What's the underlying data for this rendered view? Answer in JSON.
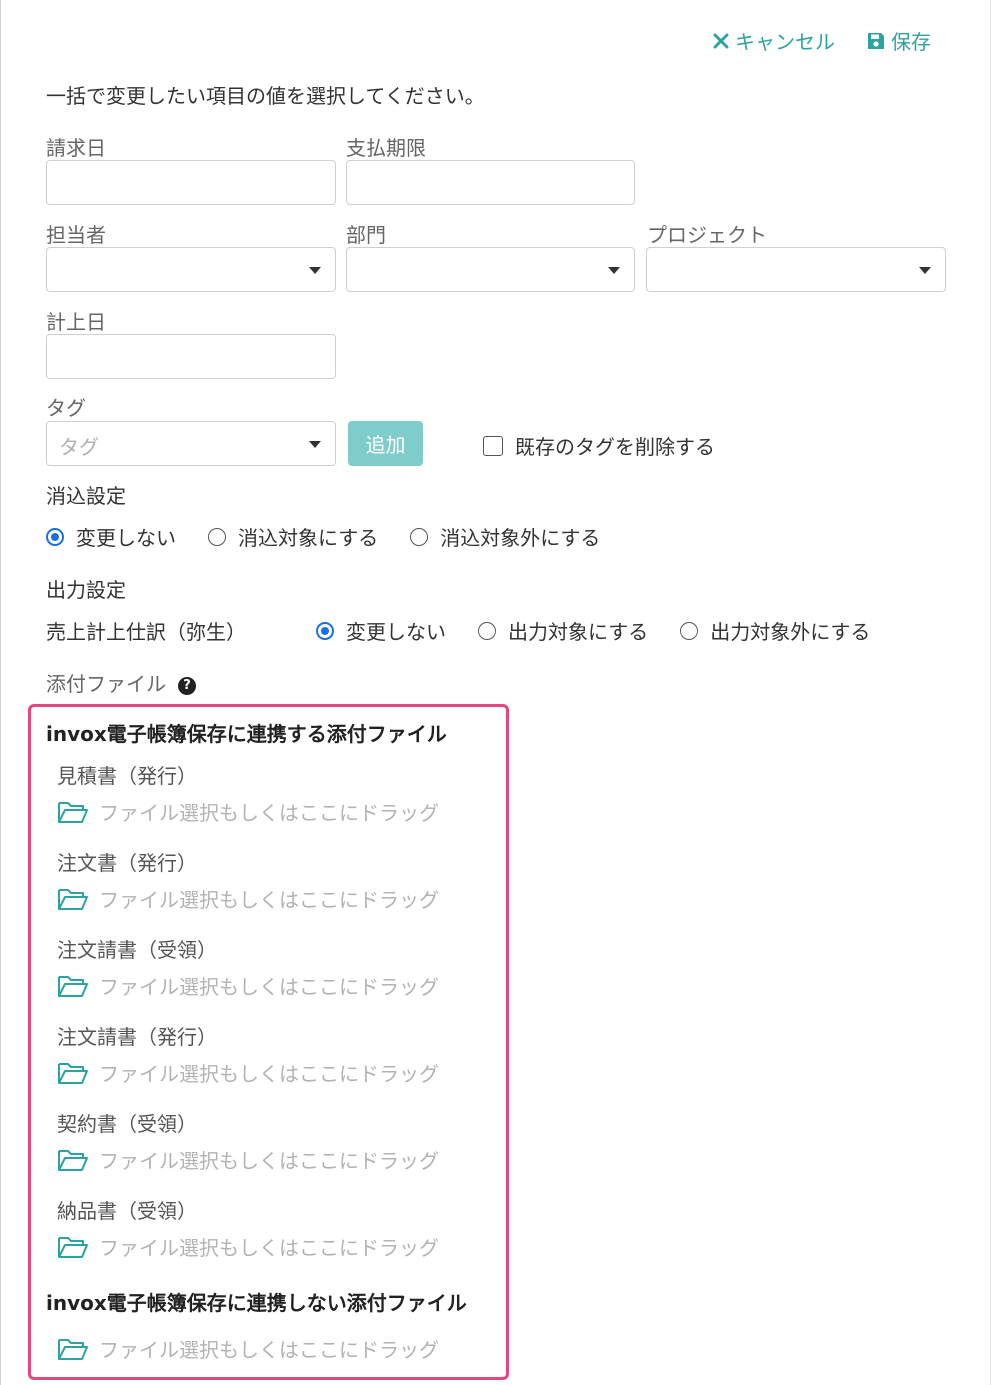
{
  "header": {
    "cancel_label": "キャンセル",
    "save_label": "保存",
    "accent_color": "#2ba3a0"
  },
  "instruction": "一括で変更したい項目の値を選択してください。",
  "fields": {
    "invoice_date_label": "請求日",
    "payment_due_label": "支払期限",
    "person_label": "担当者",
    "department_label": "部門",
    "project_label": "プロジェクト",
    "posting_date_label": "計上日",
    "tag_label": "タグ",
    "tag_placeholder": "タグ",
    "add_button": "追加",
    "delete_tags_label": "既存のタグを削除する"
  },
  "reconcile": {
    "title": "消込設定",
    "options": [
      "変更しない",
      "消込対象にする",
      "消込対象外にする"
    ],
    "selected": "変更しない"
  },
  "output": {
    "title": "出力設定",
    "row_label": "売上計上仕訳（弥生）",
    "options": [
      "変更しない",
      "出力対象にする",
      "出力対象外にする"
    ],
    "selected": "変更しない"
  },
  "attachments": {
    "title": "添付ファイル",
    "help_icon": "question-circle-icon",
    "linked_title": "invox電子帳簿保存に連携する添付ファイル",
    "docs": [
      "見積書（発行）",
      "注文書（発行）",
      "注文請書（受領）",
      "注文請書（発行）",
      "契約書（受領）",
      "納品書（受領）"
    ],
    "unlinked_title": "invox電子帳簿保存に連携しない添付ファイル",
    "drop_text": "ファイル選択もしくはここにドラッグ",
    "highlight_color": "#e8457a"
  }
}
